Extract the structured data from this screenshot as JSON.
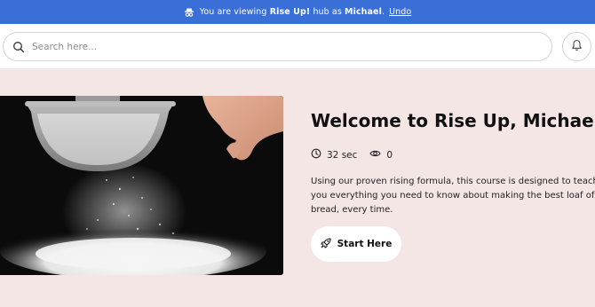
{
  "banner": {
    "prefix": "You are viewing",
    "hub_name": "Rise Up!",
    "middle": "hub as",
    "user_name": "Michael",
    "suffix": ".",
    "undo_label": "Undo",
    "icon": "spy-icon"
  },
  "search": {
    "placeholder": "Search here...",
    "icon": "search-icon"
  },
  "notifications": {
    "icon": "bell-icon"
  },
  "course": {
    "title": "Welcome to Rise Up, Michael!",
    "duration": "32 sec",
    "views": "0",
    "description": "Using our proven rising formula, this course is designed to teach you everything you need to know about making the best loaf of bread, every time.",
    "start_label": "Start Here"
  },
  "colors": {
    "banner": "#3b6fd8",
    "page_bg": "#f4e6e5",
    "button_bg": "#ffffff"
  }
}
